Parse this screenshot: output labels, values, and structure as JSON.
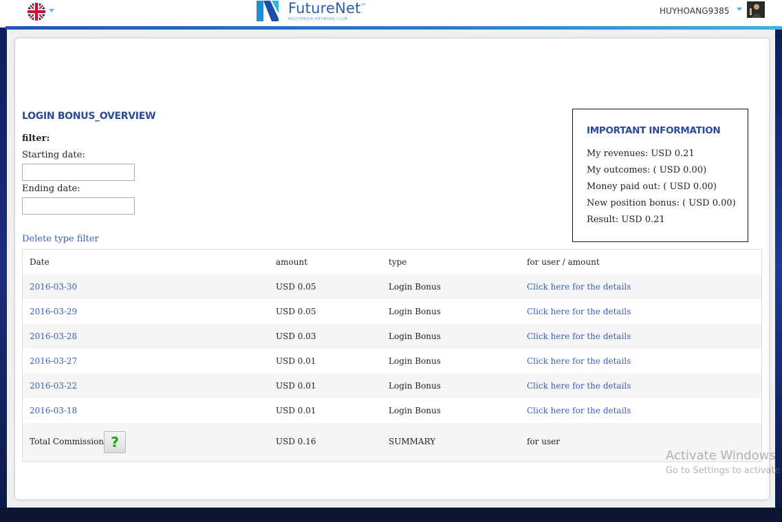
{
  "header": {
    "language": "English (UK)",
    "brand_name": "FutureNet",
    "brand_tm": "™",
    "brand_tagline": "MULTIMEDIA NETWORK CLUB",
    "username": "HUYHOANG9385"
  },
  "page": {
    "title": "LOGIN BONUS_OVERVIEW",
    "filter_label": "filter:",
    "start_label": "Starting date:",
    "start_value": "",
    "end_label": "Ending date:",
    "end_value": "",
    "delete_filter": "Delete type filter"
  },
  "info": {
    "title": "IMPORTANT INFORMATION",
    "lines": [
      "My revenues: USD 0.21",
      "My outcomes: ( USD 0.00)",
      "Money paid out: ( USD 0.00)",
      "New position bonus: ( USD 0.00)",
      "Result: USD 0.21"
    ]
  },
  "table": {
    "headers": [
      "Date",
      "amount",
      "type",
      "for user / amount"
    ],
    "rows": [
      {
        "date": "2016-03-30",
        "amount": "USD 0.05",
        "type": "Login Bonus",
        "details": "Click here for the details"
      },
      {
        "date": "2016-03-29",
        "amount": "USD 0.05",
        "type": "Login Bonus",
        "details": "Click here for the details"
      },
      {
        "date": "2016-03-28",
        "amount": "USD 0.03",
        "type": "Login Bonus",
        "details": "Click here for the details"
      },
      {
        "date": "2016-03-27",
        "amount": "USD 0.01",
        "type": "Login Bonus",
        "details": "Click here for the details"
      },
      {
        "date": "2016-03-22",
        "amount": "USD 0.01",
        "type": "Login Bonus",
        "details": "Click here for the details"
      },
      {
        "date": "2016-03-18",
        "amount": "USD 0.01",
        "type": "Login Bonus",
        "details": "Click here for the details"
      }
    ],
    "total": {
      "label": "Total Commission",
      "help": "?",
      "amount": "USD 0.16",
      "type": "SUMMARY",
      "user": "for user"
    }
  },
  "watermark": {
    "title": "Activate Windows",
    "subtitle": "Go to Settings to activate"
  },
  "colors": {
    "accent": "#2a4a9c",
    "link": "#3a5fb8",
    "help_green": "#1aa31a"
  },
  "icons": {
    "language": "uk-flag-icon",
    "logo": "futurenet-logo",
    "avatar": "user-avatar"
  }
}
